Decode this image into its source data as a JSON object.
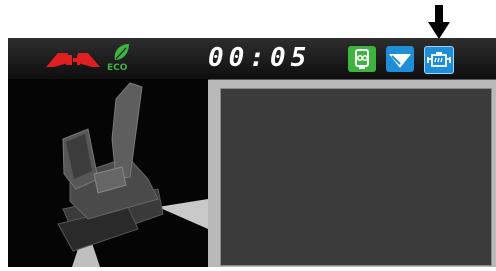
{
  "status_bar": {
    "clock_text": "00:05",
    "eco_label": "ECO",
    "icons": {
      "travel_mode": "travel-mode-icon",
      "eco": "eco-leaf-icon",
      "filter": "filter-icon",
      "wiper": "wiper-icon",
      "engine": "engine-warning-icon"
    },
    "colors": {
      "travel_mode": "#e02020",
      "eco": "#3fb33f",
      "filter": "#3fb33f",
      "wiper": "#1e8fd6",
      "engine": "#1e8fd6"
    }
  },
  "pointer": {
    "icon": "down-arrow-icon"
  },
  "main_view": {
    "image": "excavator-3d-view"
  },
  "display_panel": {
    "content": ""
  }
}
